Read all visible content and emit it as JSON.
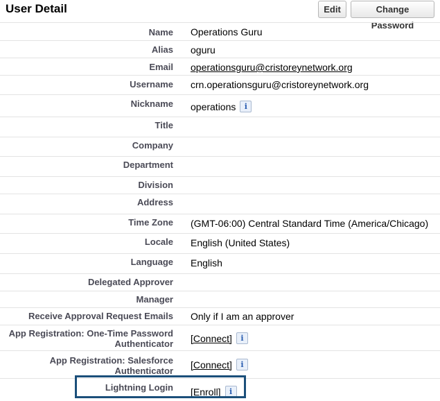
{
  "section": {
    "title": "User Detail",
    "edit_label": "Edit",
    "change_password_label": "Change Password"
  },
  "fields": {
    "name": {
      "label": "Name",
      "value": "Operations Guru"
    },
    "alias": {
      "label": "Alias",
      "value": "oguru"
    },
    "email": {
      "label": "Email",
      "value": "operationsguru@cristoreynetwork.org"
    },
    "username": {
      "label": "Username",
      "value": "crn.operationsguru@cristoreynetwork.org"
    },
    "nickname": {
      "label": "Nickname",
      "value": "operations"
    },
    "title": {
      "label": "Title",
      "value": ""
    },
    "company": {
      "label": "Company",
      "value": ""
    },
    "department": {
      "label": "Department",
      "value": ""
    },
    "division": {
      "label": "Division",
      "value": ""
    },
    "address": {
      "label": "Address",
      "value": ""
    },
    "timezone": {
      "label": "Time Zone",
      "value": "(GMT-06:00) Central Standard Time (America/Chicago)"
    },
    "locale": {
      "label": "Locale",
      "value": "English (United States)"
    },
    "language": {
      "label": "Language",
      "value": "English"
    },
    "delegated_approver": {
      "label": "Delegated Approver",
      "value": ""
    },
    "manager": {
      "label": "Manager",
      "value": ""
    },
    "approval_emails": {
      "label": "Receive Approval Request Emails",
      "value": "Only if I am an approver"
    },
    "otp_auth": {
      "label_line1": "App Registration: One-Time Password",
      "label_line2": "Authenticator",
      "value": "[Connect]"
    },
    "sf_auth": {
      "label_line1": "App Registration: Salesforce",
      "label_line2": "Authenticator",
      "value": "[Connect]"
    },
    "lightning_login": {
      "label": "Lightning Login",
      "value": "[Enroll]"
    }
  },
  "icons": {
    "info_glyph": "i"
  },
  "colors": {
    "label_text": "#4a4a56",
    "row_border": "#e3e3e3",
    "highlight_border": "#1b4f7a",
    "info_icon": "#2a5db0"
  }
}
